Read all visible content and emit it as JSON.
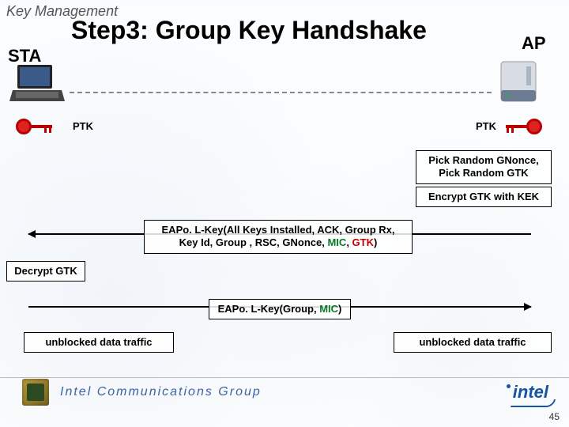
{
  "header": {
    "section": "Key Management"
  },
  "title": "Step3: Group Key Handshake",
  "endpoints": {
    "sta": "STA",
    "ap": "AP"
  },
  "keys": {
    "ptk_left": "PTK",
    "ptk_right": "PTK"
  },
  "boxes": {
    "gnonce": "Pick Random GNonce,\nPick Random GTK",
    "kek": "Encrypt GTK with KEK",
    "eapol1_pre": "EAPo. L-Key(All Keys Installed, ACK, Group Rx,\nKey Id, Group , RSC, GNonce, ",
    "eapol1_mic": "MIC",
    "eapol1_sep": ", ",
    "eapol1_gtk": "GTK",
    "eapol1_post": ")",
    "decrypt": "Decrypt GTK",
    "eapol2_pre": "EAPo. L-Key(Group, ",
    "eapol2_mic": "MIC",
    "eapol2_post": ")",
    "unblocked_left": "unblocked data traffic",
    "unblocked_right": "unblocked data traffic"
  },
  "footer": {
    "group": "Intel Communications Group",
    "brand": "intel"
  },
  "slide_number": "45",
  "colors": {
    "mic": "#0a7a28",
    "gtk": "#c00000",
    "brand": "#1653a3"
  }
}
